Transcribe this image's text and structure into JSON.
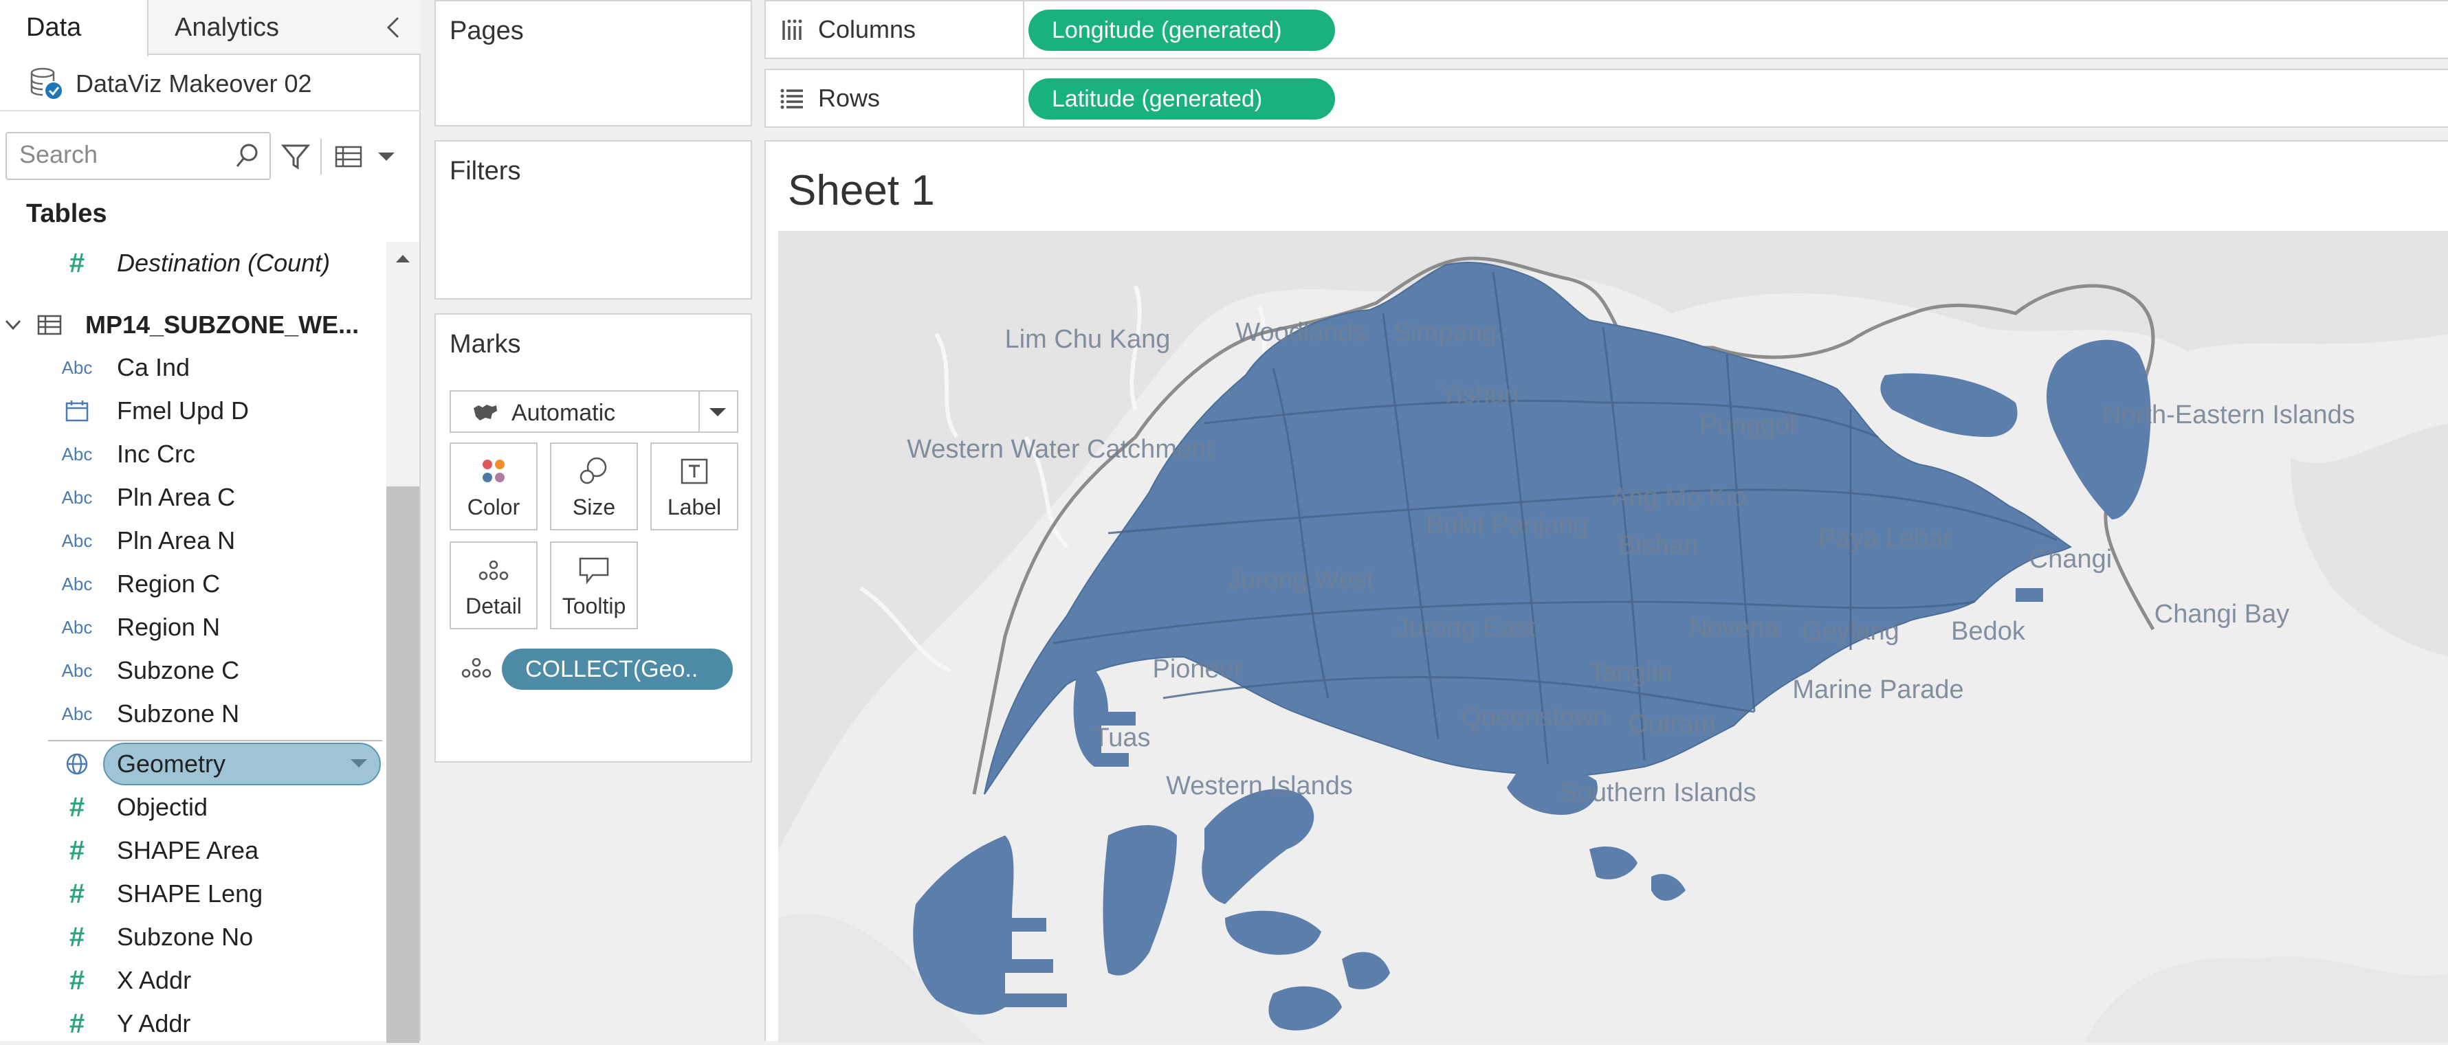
{
  "tabs": {
    "data": "Data",
    "analytics": "Analytics"
  },
  "datasource": {
    "name": "DataViz Makeover 02"
  },
  "search": {
    "placeholder": "Search"
  },
  "tables_heading": "Tables",
  "fields_top": [
    {
      "name": "Destination (Count)",
      "type": "number"
    }
  ],
  "table": {
    "name": "MP14_SUBZONE_WE...",
    "fields": [
      {
        "name": "Ca Ind",
        "type": "string"
      },
      {
        "name": "Fmel Upd D",
        "type": "date"
      },
      {
        "name": "Inc Crc",
        "type": "string"
      },
      {
        "name": "Pln Area C",
        "type": "string"
      },
      {
        "name": "Pln Area N",
        "type": "string"
      },
      {
        "name": "Region C",
        "type": "string"
      },
      {
        "name": "Region N",
        "type": "string"
      },
      {
        "name": "Subzone C",
        "type": "string"
      },
      {
        "name": "Subzone N",
        "type": "string"
      },
      {
        "name": "Geometry",
        "type": "geo",
        "selected": true
      },
      {
        "name": "Objectid",
        "type": "number"
      },
      {
        "name": "SHAPE Area",
        "type": "number"
      },
      {
        "name": "SHAPE Leng",
        "type": "number"
      },
      {
        "name": "Subzone No",
        "type": "number"
      },
      {
        "name": "X Addr",
        "type": "number"
      },
      {
        "name": "Y Addr",
        "type": "number"
      }
    ]
  },
  "pages": {
    "title": "Pages"
  },
  "filters": {
    "title": "Filters"
  },
  "marks": {
    "title": "Marks",
    "type": "Automatic",
    "buttons": {
      "color": "Color",
      "size": "Size",
      "label": "Label",
      "detail": "Detail",
      "tooltip": "Tooltip"
    },
    "pill": "COLLECT(Geo.."
  },
  "columns": {
    "label": "Columns",
    "pill": "Longitude (generated)"
  },
  "rows": {
    "label": "Rows",
    "pill": "Latitude (generated)"
  },
  "sheet": {
    "title": "Sheet 1"
  },
  "map": {
    "fill_color": "#5b7faa",
    "labels": [
      "Lim Chu Kang",
      "Woodlands",
      "Simpang",
      "Yishun",
      "Punggol",
      "North-Eastern Islands",
      "Western Water Catchment",
      "Bukit Panjang",
      "Ang Mo Kio",
      "Bishan",
      "Paya Lebar",
      "Changi",
      "Jurong West",
      "Jurong East",
      "Novena",
      "Geylang",
      "Bedok",
      "Changi Bay",
      "Pioneer",
      "Tanglin",
      "Marine Parade",
      "Queenstown",
      "Outram",
      "Tuas",
      "Western Islands",
      "Southern Islands"
    ]
  },
  "colors": {
    "green_pill": "#1ab27c",
    "blue_pill": "#4d8ba6",
    "selected_field": "#9fc4d6"
  }
}
